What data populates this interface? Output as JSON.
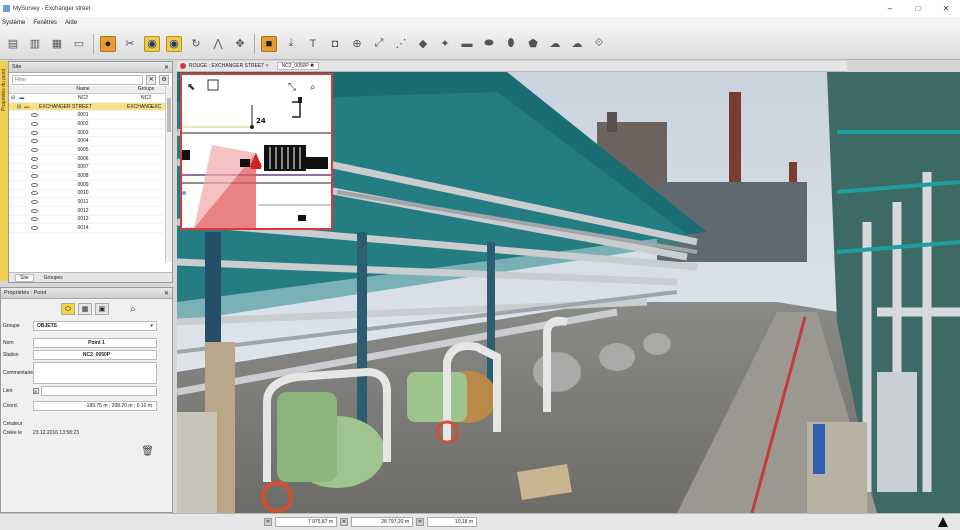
{
  "window": {
    "title": "MySurvey - Exchanger street"
  },
  "menu": [
    "Système",
    "Fenêtres",
    "Aide"
  ],
  "toolbar": {
    "icons": [
      "open-icon",
      "save-icon",
      "export-icon",
      "screen-icon",
      "point-tool-icon",
      "scissors-icon",
      "eye-icon",
      "eye-alt-icon",
      "rotate-icon",
      "tripod-icon",
      "move-icon",
      "highlight-icon",
      "download-icon",
      "text-icon",
      "camera-icon",
      "target-icon",
      "measure-icon",
      "polyline-icon",
      "surface-icon",
      "hull-icon",
      "pipe-icon",
      "pipe2-icon",
      "cylinder-icon",
      "shape-icon",
      "cloud-icon",
      "cloud2-icon",
      "cloud3-icon"
    ]
  },
  "tree": {
    "panel_title": "Site",
    "filter_placeholder": "Filter",
    "columns": [
      "Name",
      "Groups"
    ],
    "rows": [
      {
        "name": "NC2",
        "group": "NC2",
        "highlight": false
      },
      {
        "name": "EXCHANGER STREET",
        "group": "EXCHANG...",
        "group2": "EXC",
        "highlight": true
      },
      {
        "name": "0001",
        "group": ""
      },
      {
        "name": "0002",
        "group": ""
      },
      {
        "name": "0003",
        "group": ""
      },
      {
        "name": "0004",
        "group": ""
      },
      {
        "name": "0005",
        "group": ""
      },
      {
        "name": "0006",
        "group": ""
      },
      {
        "name": "0007",
        "group": ""
      },
      {
        "name": "0008",
        "group": ""
      },
      {
        "name": "0009",
        "group": ""
      },
      {
        "name": "0010",
        "group": ""
      },
      {
        "name": "0011",
        "group": ""
      },
      {
        "name": "0012",
        "group": ""
      },
      {
        "name": "0013",
        "group": ""
      },
      {
        "name": "0014",
        "group": ""
      }
    ],
    "tabs": [
      "Site",
      "Groupes"
    ],
    "vertical_tab": "Propriétés du point"
  },
  "properties": {
    "panel_title": "Propriétés : Point",
    "group_label": "Groupe",
    "group_value": "OBJETS",
    "name_label": "Nom",
    "name_value": "Point 1",
    "station_label": "Station",
    "station_value": "NC2_0050P",
    "comment_label": "Commentaire",
    "comment_value": "",
    "link_label": "Lien",
    "link_value": "",
    "coord_label": "Coord.",
    "coord_value": "-189.75 m ; 208.20 m ; 0.10 m",
    "creator_label": "Créateur",
    "created_label": "Créée le",
    "created_value": "23.12.2016 13:58:23"
  },
  "view": {
    "breadcrumb": "ROUGE : EXCHANGER STREET >",
    "station_tab": "NC2_0050P ✖"
  },
  "minimap": {
    "label": "24"
  },
  "status": {
    "field1": "7 975,87 m",
    "field2": "28 797,20 m",
    "field3": "10,18 m"
  }
}
